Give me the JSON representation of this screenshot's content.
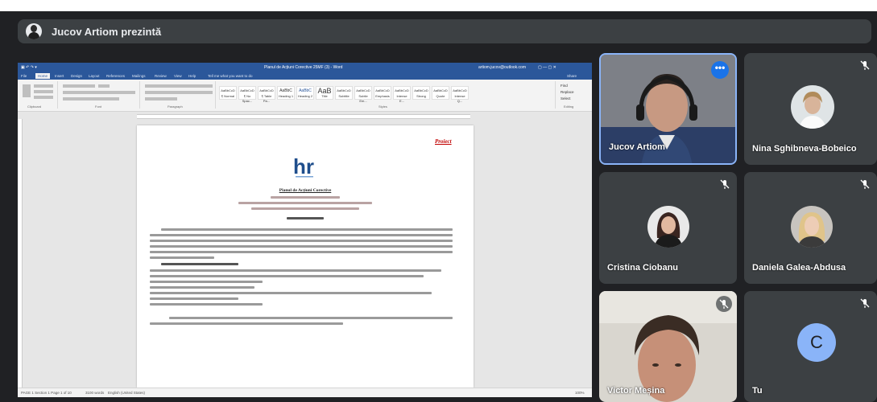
{
  "presentation_bar": {
    "presenter_text": "Jucov Artiom prezintă"
  },
  "word": {
    "window_title": "Planul de Acțiuni Corective 25MF (3) - Word",
    "account": "artiom.jucov@outlook.com",
    "tabs": [
      "File",
      "Home",
      "Insert",
      "Design",
      "Layout",
      "References",
      "Mailings",
      "Review",
      "View",
      "Help"
    ],
    "tell_me": "Tell me what you want to do",
    "share": "Share",
    "ribbon_groups": [
      "Clipboard",
      "Font",
      "Paragraph",
      "Styles",
      "Editing"
    ],
    "styles": [
      "¶ Normal",
      "¶ No Spac...",
      "¶ Table Pa...",
      "Heading 1",
      "Heading 2",
      "Title",
      "Subtitle",
      "Subtle Em...",
      "Emphasis",
      "Intense E...",
      "Strong",
      "Quote",
      "Intense Q..."
    ],
    "editing": [
      "Find",
      "Replace",
      "Select"
    ],
    "status": {
      "page": "PAGE 1 Section 1 Page 1 of 10",
      "words": "3100 words",
      "language": "English (United States)",
      "zoom": "100%"
    }
  },
  "document": {
    "proiect_label": "Proiect",
    "logo_text": "hr",
    "title": "Planul de Acțiuni Corective"
  },
  "tiles": [
    {
      "name": "Jucov Artiom",
      "muted": false
    },
    {
      "name": "Nina Sghibneva-Bobeico",
      "muted": true
    },
    {
      "name": "Cristina Ciobanu",
      "muted": true
    },
    {
      "name": "Daniela Galea-Abdusa",
      "muted": true
    },
    {
      "name": "Victor Meșina",
      "muted": true
    },
    {
      "name": "Tu",
      "muted": true,
      "avatar_letter": "C"
    }
  ],
  "colors": {
    "meet_bg": "#202124",
    "tile_bg": "#3c4043",
    "word_blue": "#2b579a",
    "active_speaker": "#8ab4f8"
  }
}
